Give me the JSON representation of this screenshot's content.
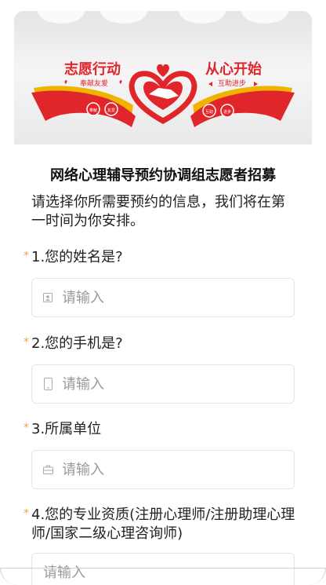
{
  "banner": {
    "left_title": "志愿行动",
    "left_sub": "奉献友爱",
    "right_title": "从心开始",
    "right_sub": "互助进步",
    "badges": [
      "奉献",
      "友爱",
      "互助",
      "进步"
    ]
  },
  "form": {
    "title": "网络心理辅导预约协调组志愿者招募",
    "description": "请选择你所需要预约的信息，我们将在第一时间为你安排。",
    "questions": [
      {
        "label": "1.您的姓名是?",
        "placeholder": "请输入",
        "icon": "user-card-icon",
        "required": "*"
      },
      {
        "label": "2.您的手机是?",
        "placeholder": "请输入",
        "icon": "phone-icon",
        "required": "*"
      },
      {
        "label": "3.所属单位",
        "placeholder": "请输入",
        "icon": "briefcase-icon",
        "required": "*"
      },
      {
        "label": "4.您的专业资质(注册心理师/注册助理心理师/国家二级心理咨询师)",
        "placeholder": "请输入",
        "icon": "",
        "required": "*"
      }
    ]
  },
  "colors": {
    "accent_red": "#e1262b",
    "required_star": "#f0a33a"
  }
}
